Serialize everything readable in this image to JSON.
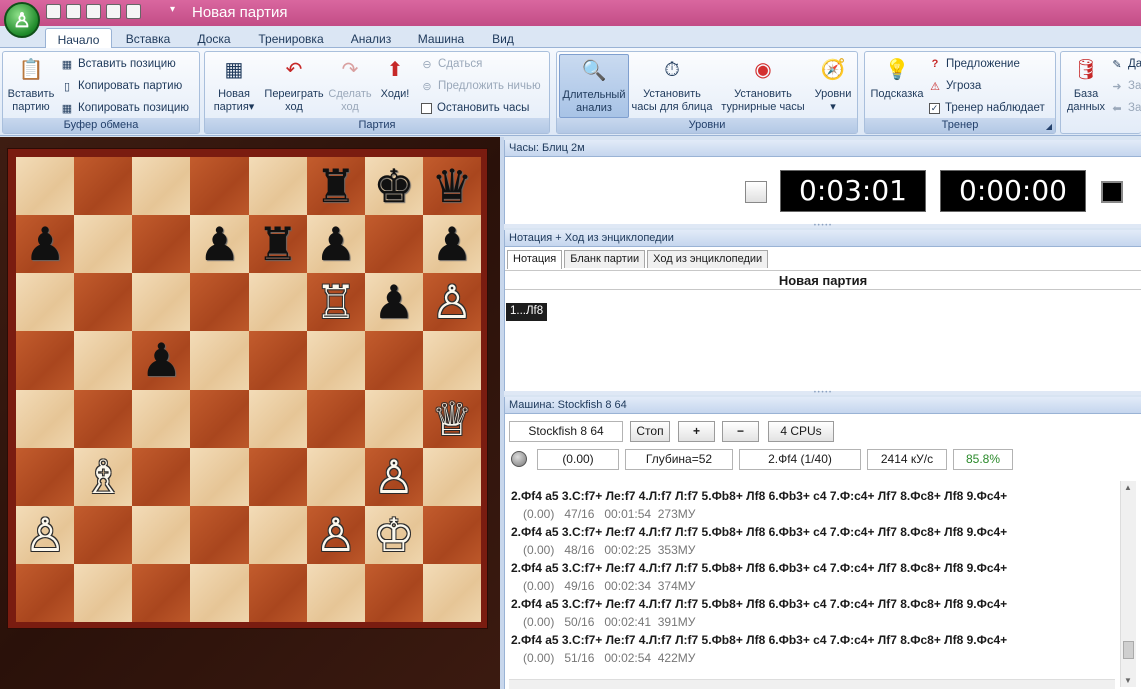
{
  "window": {
    "title": "Новая партия"
  },
  "tabs": [
    "Начало",
    "Вставка",
    "Доска",
    "Тренировка",
    "Анализ",
    "Машина",
    "Вид"
  ],
  "ribbon": {
    "clipboard": {
      "group": "Буфер обмена",
      "paste": "Вставить партию",
      "paste_pos": "Вставить позицию",
      "copy_game": "Копировать партию",
      "copy_pos": "Копировать позицию"
    },
    "game": {
      "group": "Партия",
      "new_game": "Новая партия",
      "replay": "Переиграть ход",
      "make_move": "Сделать ход",
      "your_move": "Ходи!",
      "resign": "Сдаться",
      "offer_draw": "Предложить ничью",
      "stop_clocks": "Остановить часы"
    },
    "levels": {
      "group": "Уровни",
      "long_analysis": "Длительный анализ",
      "blitz_clock": "Установить часы для блица",
      "tourn_clock": "Установить турнирные часы",
      "levels_btn": "Уровни"
    },
    "trainer": {
      "group": "Тренер",
      "hint": "Подсказка",
      "suggestion": "Предложение",
      "threat": "Угроза",
      "trainer_watch": "Тренер наблюдает"
    },
    "database": {
      "label": "База данных",
      "extra": [
        "Да",
        "За",
        "За"
      ]
    }
  },
  "board": {
    "pieces": [
      {
        "sq": "f8",
        "p": "♜",
        "c": "b"
      },
      {
        "sq": "g8",
        "p": "♚",
        "c": "b"
      },
      {
        "sq": "h8",
        "p": "♛",
        "c": "b"
      },
      {
        "sq": "a7",
        "p": "♟",
        "c": "b"
      },
      {
        "sq": "d7",
        "p": "♟",
        "c": "b"
      },
      {
        "sq": "e7",
        "p": "♜",
        "c": "b"
      },
      {
        "sq": "f7",
        "p": "♟",
        "c": "b"
      },
      {
        "sq": "h7",
        "p": "♟",
        "c": "b"
      },
      {
        "sq": "f6",
        "p": "♖",
        "c": "w"
      },
      {
        "sq": "g6",
        "p": "♟",
        "c": "b"
      },
      {
        "sq": "h6",
        "p": "♙",
        "c": "w"
      },
      {
        "sq": "c5",
        "p": "♟",
        "c": "b"
      },
      {
        "sq": "h4",
        "p": "♕",
        "c": "w"
      },
      {
        "sq": "b3",
        "p": "♗",
        "c": "w"
      },
      {
        "sq": "g3",
        "p": "♙",
        "c": "w"
      },
      {
        "sq": "a2",
        "p": "♙",
        "c": "w"
      },
      {
        "sq": "f2",
        "p": "♙",
        "c": "w"
      },
      {
        "sq": "g2",
        "p": "♔",
        "c": "w"
      }
    ]
  },
  "clock": {
    "title": "Часы: Блиц 2м",
    "white_time": "0:03:01",
    "black_time": "0:00:00"
  },
  "notation": {
    "title": "Нотация + Ход из энциклопедии",
    "tabs": [
      "Нотация",
      "Бланк партии",
      "Ход из энциклопедии"
    ],
    "game_title": "Новая партия",
    "move": "1...Лf8"
  },
  "engine": {
    "title": "Машина: Stockfish 8 64",
    "name": "Stockfish 8 64",
    "stop": "Стоп",
    "plus": "+",
    "minus": "−",
    "cpus": "4 CPUs",
    "eval": "(0.00)",
    "depth": "Глубина=52",
    "current": "2.Фf4 (1/40)",
    "speed": "2414 кУ/с",
    "percent": "85.8%",
    "lines": [
      {
        "moves": "2.Фf4 a5 3.С:f7+ Лe:f7 4.Л:f7 Л:f7 5.Фb8+ Лf8 6.Фb3+ c4 7.Ф:c4+ Лf7 8.Фc8+ Лf8 9.Фc4+",
        "stats": "(0.00)   47/16   00:01:54  273МУ"
      },
      {
        "moves": "2.Фf4 a5 3.С:f7+ Лe:f7 4.Л:f7 Л:f7 5.Фb8+ Лf8 6.Фb3+ c4 7.Ф:c4+ Лf7 8.Фc8+ Лf8 9.Фc4+",
        "stats": "(0.00)   48/16   00:02:25  353МУ"
      },
      {
        "moves": "2.Фf4 a5 3.С:f7+ Лe:f7 4.Л:f7 Л:f7 5.Фb8+ Лf8 6.Фb3+ c4 7.Ф:c4+ Лf7 8.Фc8+ Лf8 9.Фc4+",
        "stats": "(0.00)   49/16   00:02:34  374МУ"
      },
      {
        "moves": "2.Фf4 a5 3.С:f7+ Лe:f7 4.Л:f7 Л:f7 5.Фb8+ Лf8 6.Фb3+ c4 7.Ф:c4+ Лf7 8.Фc8+ Лf8 9.Фc4+",
        "stats": "(0.00)   50/16   00:02:41  391МУ"
      },
      {
        "moves": "2.Фf4 a5 3.С:f7+ Лe:f7 4.Л:f7 Л:f7 5.Фb8+ Лf8 6.Фb3+ c4 7.Ф:c4+ Лf7 8.Фc8+ Лf8 9.Фc4+",
        "stats": "(0.00)   51/16   00:02:54  422МУ"
      }
    ]
  },
  "colors": {
    "title_bar": "#c94f8c",
    "board_light": "#f3dcb8",
    "board_dark": "#b8522a",
    "percent_green": "#2a8a2a"
  }
}
